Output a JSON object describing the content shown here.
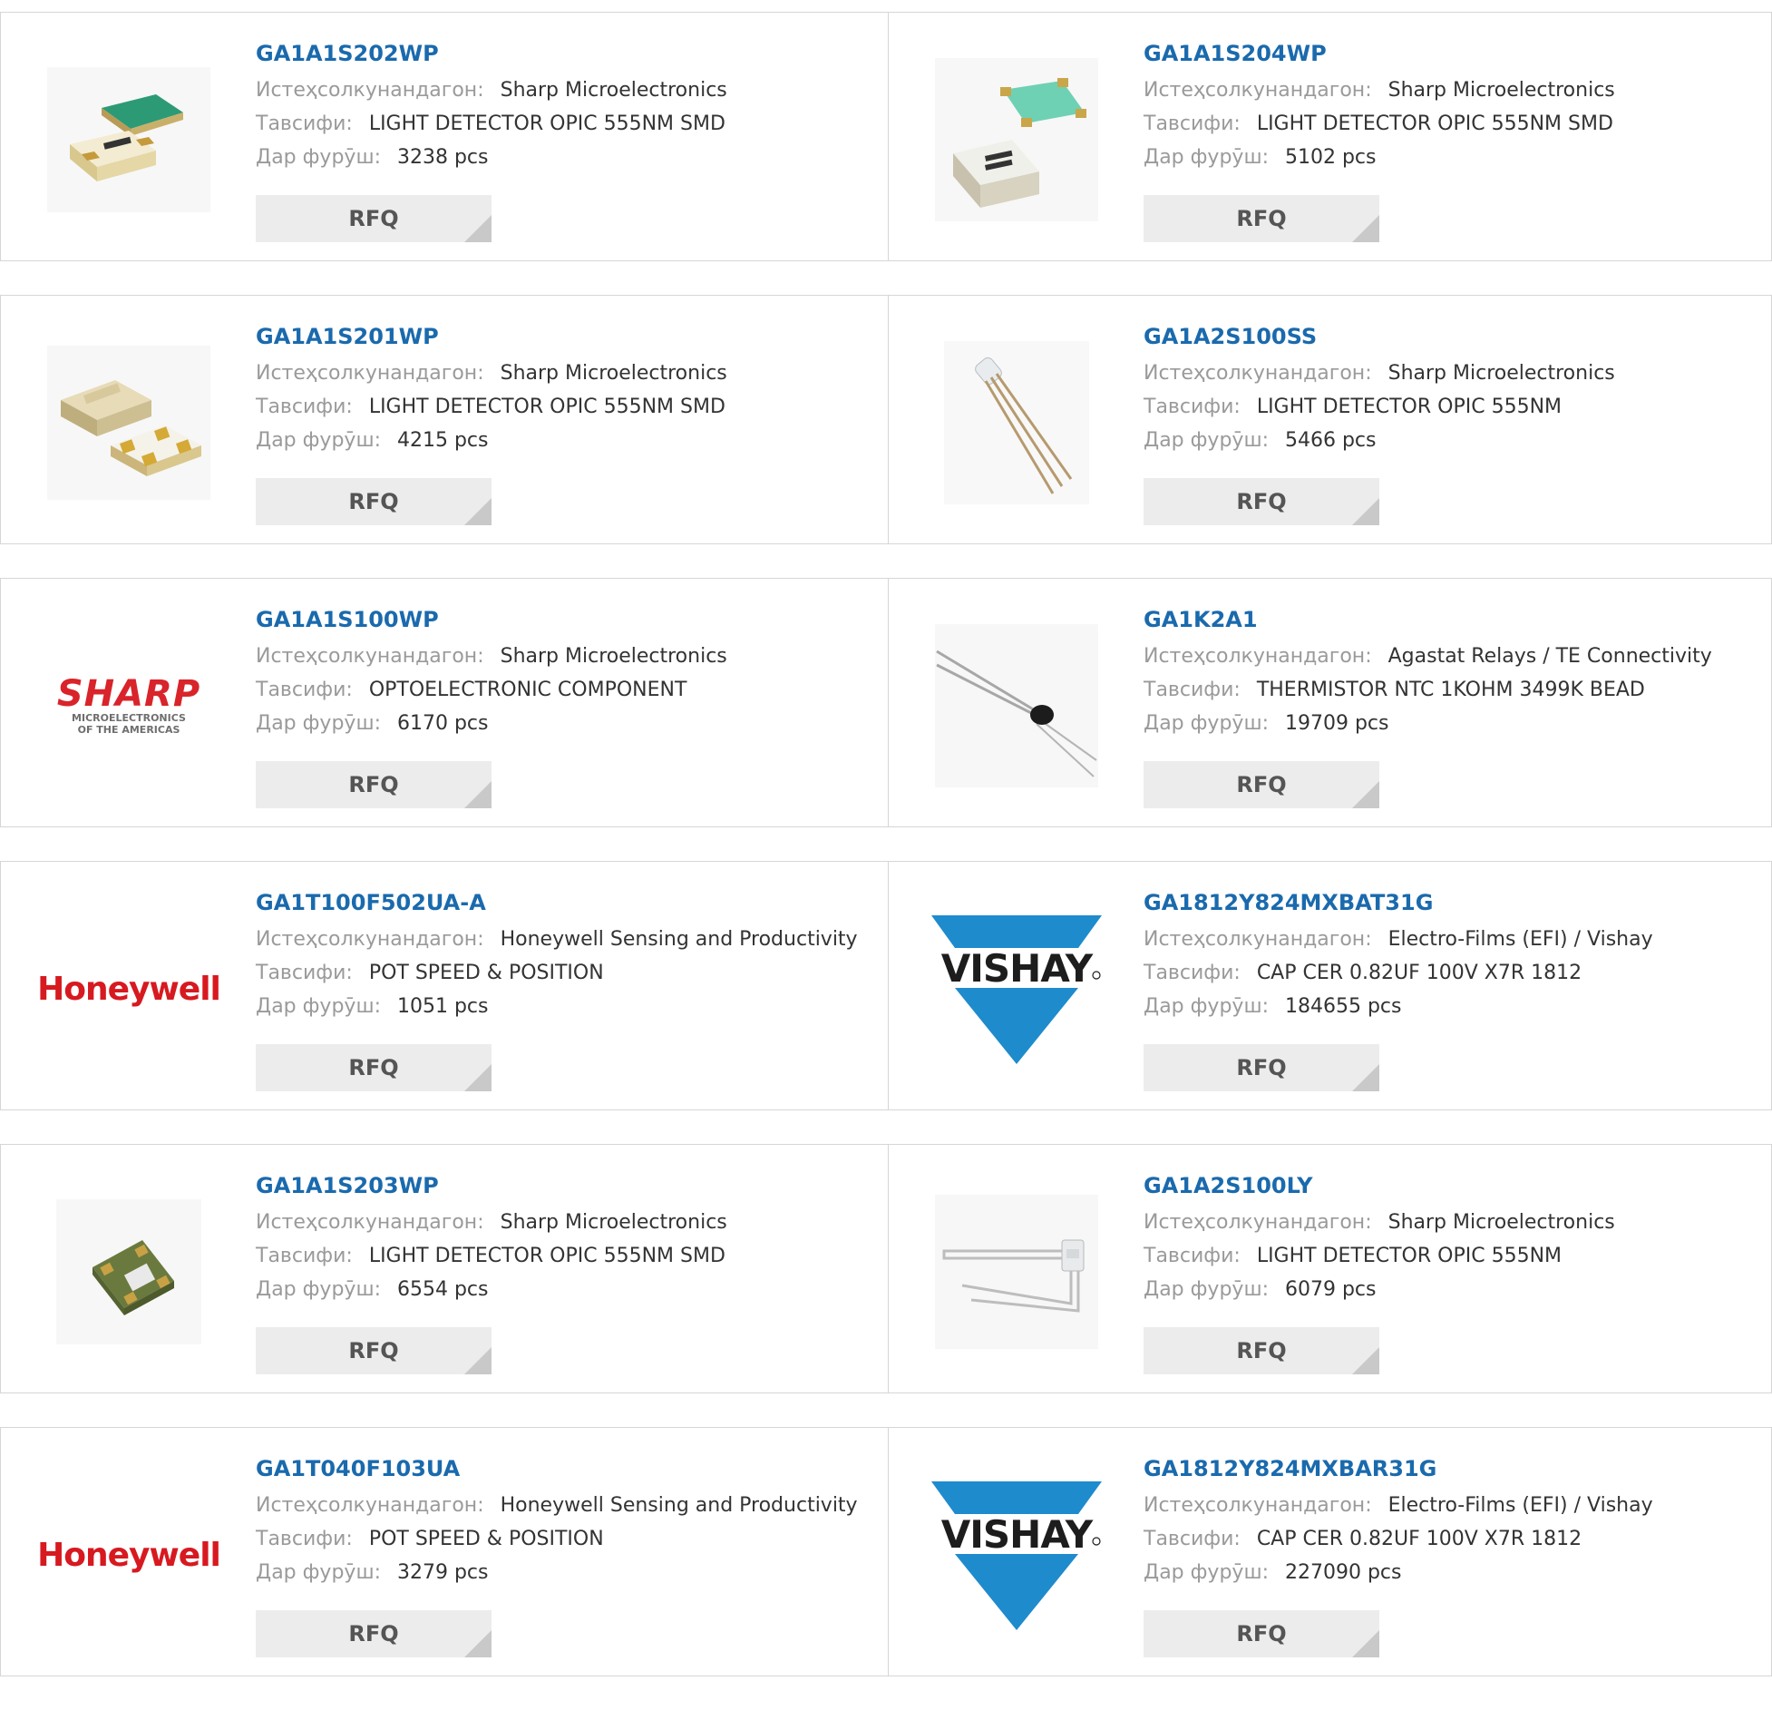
{
  "labels": {
    "manufacturer": "Истеҳсолкунандагон:",
    "description": "Тавсифи:",
    "stock": "Дар фурӯш:",
    "rfq": "RFQ"
  },
  "logos": {
    "sharp_main": "SHARP",
    "sharp_sub_1": "MICROELECTRONICS",
    "sharp_sub_2": "OF THE AMERICAS",
    "honeywell": "Honeywell",
    "vishay": "VISHAY"
  },
  "products": [
    {
      "pn": "GA1A1S202WP",
      "manufacturer": "Sharp Microelectronics",
      "description": "LIGHT DETECTOR OPIC 555NM SMD",
      "stock": "3238 pcs",
      "image": "smd-sensor-green-image"
    },
    {
      "pn": "GA1A1S204WP",
      "manufacturer": "Sharp Microelectronics",
      "description": "LIGHT DETECTOR OPIC 555NM SMD",
      "stock": "5102 pcs",
      "image": "smd-sensor-teal-image"
    },
    {
      "pn": "GA1A1S201WP",
      "manufacturer": "Sharp Microelectronics",
      "description": "LIGHT DETECTOR OPIC 555NM SMD",
      "stock": "4215 pcs",
      "image": "smd-sensor-gold-image"
    },
    {
      "pn": "GA1A2S100SS",
      "manufacturer": "Sharp Microelectronics",
      "description": "LIGHT DETECTOR OPIC 555NM",
      "stock": "5466 pcs",
      "image": "through-hole-sensor-image"
    },
    {
      "pn": "GA1A1S100WP",
      "manufacturer": "Sharp Microelectronics",
      "description": "OPTOELECTRONIC COMPONENT",
      "stock": "6170 pcs",
      "image": "sharp-logo"
    },
    {
      "pn": "GA1K2A1",
      "manufacturer": "Agastat Relays / TE Connectivity",
      "description": "THERMISTOR NTC 1KOHM 3499K BEAD",
      "stock": "19709 pcs",
      "image": "thermistor-bead-image"
    },
    {
      "pn": "GA1T100F502UA-A",
      "manufacturer": "Honeywell Sensing and Productivity",
      "description": "POT SPEED & POSITION",
      "stock": "1051 pcs",
      "image": "honeywell-logo"
    },
    {
      "pn": "GA1812Y824MXBAT31G",
      "manufacturer": "Electro-Films (EFI) / Vishay",
      "description": "CAP CER 0.82UF 100V X7R 1812",
      "stock": "184655 pcs",
      "image": "vishay-logo"
    },
    {
      "pn": "GA1A1S203WP",
      "manufacturer": "Sharp Microelectronics",
      "description": "LIGHT DETECTOR OPIC 555NM SMD",
      "stock": "6554 pcs",
      "image": "smd-chip-image"
    },
    {
      "pn": "GA1A2S100LY",
      "manufacturer": "Sharp Microelectronics",
      "description": "LIGHT DETECTOR OPIC 555NM",
      "stock": "6079 pcs",
      "image": "bent-lead-sensor-image"
    },
    {
      "pn": "GA1T040F103UA",
      "manufacturer": "Honeywell Sensing and Productivity",
      "description": "POT SPEED & POSITION",
      "stock": "3279 pcs",
      "image": "honeywell-logo"
    },
    {
      "pn": "GA1812Y824MXBAR31G",
      "manufacturer": "Electro-Films (EFI) / Vishay",
      "description": "CAP CER 0.82UF 100V X7R 1812",
      "stock": "227090 pcs",
      "image": "vishay-logo"
    }
  ],
  "colors": {
    "link": "#1a6aad",
    "label": "#9a9a9a",
    "value": "#333333",
    "rfq_bg": "#ececec",
    "sharp_red": "#d8242a",
    "honeywell_red": "#d71920",
    "vishay_blue": "#1e8bcd"
  }
}
